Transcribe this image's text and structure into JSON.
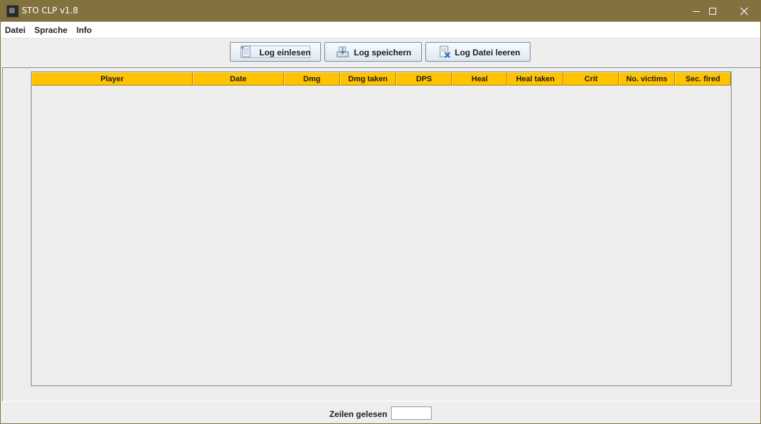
{
  "window": {
    "title": "STO CLP v1.8",
    "icon": "app-icon",
    "controls": [
      "minimize-icon",
      "maximize-icon",
      "close-icon"
    ]
  },
  "menu": {
    "items": [
      "Datei",
      "Sprache",
      "Info"
    ]
  },
  "toolbar": {
    "load_label": "Log einlesen",
    "save_label": "Log speichern",
    "clear_label": "Log Datei leeren"
  },
  "table": {
    "columns": [
      "Player",
      "Date",
      "Dmg",
      "Dmg taken",
      "DPS",
      "Heal",
      "Heal taken",
      "Crit",
      "No. victims",
      "Sec. fired"
    ],
    "rows": []
  },
  "status": {
    "lines_read_label": "Zeilen gelesen",
    "lines_read_value": ""
  },
  "colors": {
    "titlebar": "#837240",
    "header": "#ffc300"
  }
}
